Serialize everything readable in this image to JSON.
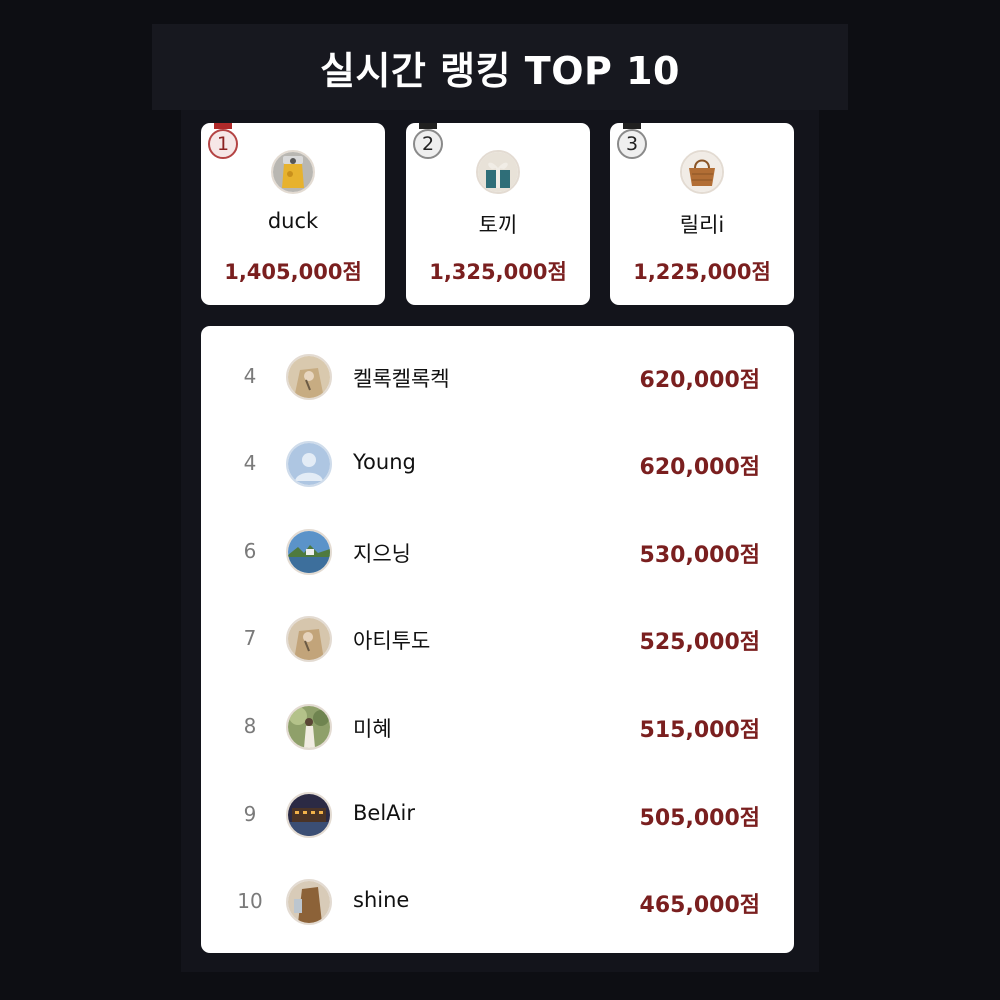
{
  "header": {
    "title": "실시간 랭킹 TOP 10"
  },
  "podium": [
    {
      "rank": "1",
      "name": "duck",
      "score": "1,405,000점",
      "avatar_icon": "yellow-pouch-photo"
    },
    {
      "rank": "2",
      "name": "토끼",
      "score": "1,325,000점",
      "avatar_icon": "gift-box-photo"
    },
    {
      "rank": "3",
      "name": "릴리i",
      "score": "1,225,000점",
      "avatar_icon": "wicker-bag-photo"
    }
  ],
  "list": [
    {
      "rank": "4",
      "name": "켈록켈록켁",
      "score": "620,000점",
      "avatar_icon": "beige-coat-photo"
    },
    {
      "rank": "4",
      "name": "Young",
      "score": "620,000점",
      "avatar_icon": "default-user-icon"
    },
    {
      "rank": "6",
      "name": "지으닝",
      "score": "530,000점",
      "avatar_icon": "harbor-photo"
    },
    {
      "rank": "7",
      "name": "아티투도",
      "score": "525,000점",
      "avatar_icon": "beige-coat-photo"
    },
    {
      "rank": "8",
      "name": "미혜",
      "score": "515,000점",
      "avatar_icon": "garden-photo"
    },
    {
      "rank": "9",
      "name": "BelAir",
      "score": "505,000점",
      "avatar_icon": "night-building-photo"
    },
    {
      "rank": "10",
      "name": "shine",
      "score": "465,000점",
      "avatar_icon": "brown-figure-photo"
    }
  ],
  "colors": {
    "background": "#0d0e13",
    "score_accent": "#7a1f1f",
    "first_place_accent": "#b02a2a"
  }
}
